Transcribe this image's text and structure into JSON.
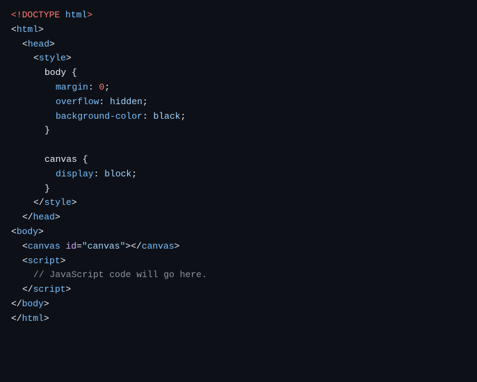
{
  "editor": {
    "background": "#0d1117",
    "lines": [
      {
        "indent": 0,
        "tokens": [
          {
            "type": "keyword",
            "text": "<!DOCTYPE "
          },
          {
            "type": "tag",
            "text": "html"
          },
          {
            "type": "keyword",
            "text": ">"
          }
        ]
      },
      {
        "indent": 0,
        "tokens": [
          {
            "type": "bracket",
            "text": "<"
          },
          {
            "type": "tag",
            "text": "html"
          },
          {
            "type": "bracket",
            "text": ">"
          }
        ]
      },
      {
        "indent": 1,
        "tokens": [
          {
            "type": "bracket",
            "text": "<"
          },
          {
            "type": "tag",
            "text": "head"
          },
          {
            "type": "bracket",
            "text": ">"
          }
        ]
      },
      {
        "indent": 2,
        "tokens": [
          {
            "type": "bracket",
            "text": "<"
          },
          {
            "type": "tag",
            "text": "style"
          },
          {
            "type": "bracket",
            "text": ">"
          }
        ]
      },
      {
        "indent": 3,
        "tokens": [
          {
            "type": "selector",
            "text": "body {"
          }
        ]
      },
      {
        "indent": 4,
        "tokens": [
          {
            "type": "prop",
            "text": "margin"
          },
          {
            "type": "plain",
            "text": ": "
          },
          {
            "type": "zero",
            "text": "0"
          },
          {
            "type": "plain",
            "text": ";"
          }
        ]
      },
      {
        "indent": 4,
        "tokens": [
          {
            "type": "prop",
            "text": "overflow"
          },
          {
            "type": "plain",
            "text": ": "
          },
          {
            "type": "cssval",
            "text": "hidden"
          },
          {
            "type": "plain",
            "text": ";"
          }
        ]
      },
      {
        "indent": 4,
        "tokens": [
          {
            "type": "prop",
            "text": "background-color"
          },
          {
            "type": "plain",
            "text": ": "
          },
          {
            "type": "cssval",
            "text": "black"
          },
          {
            "type": "plain",
            "text": ";"
          }
        ]
      },
      {
        "indent": 3,
        "tokens": [
          {
            "type": "plain",
            "text": "}"
          }
        ]
      },
      {
        "indent": 0,
        "tokens": []
      },
      {
        "indent": 3,
        "tokens": [
          {
            "type": "selector",
            "text": "canvas {"
          }
        ]
      },
      {
        "indent": 4,
        "tokens": [
          {
            "type": "prop",
            "text": "display"
          },
          {
            "type": "plain",
            "text": ": "
          },
          {
            "type": "cssval",
            "text": "block"
          },
          {
            "type": "plain",
            "text": ";"
          }
        ]
      },
      {
        "indent": 3,
        "tokens": [
          {
            "type": "plain",
            "text": "}"
          }
        ]
      },
      {
        "indent": 2,
        "tokens": [
          {
            "type": "bracket",
            "text": "</"
          },
          {
            "type": "tag",
            "text": "style"
          },
          {
            "type": "bracket",
            "text": ">"
          }
        ]
      },
      {
        "indent": 1,
        "tokens": [
          {
            "type": "bracket",
            "text": "</"
          },
          {
            "type": "tag",
            "text": "head"
          },
          {
            "type": "bracket",
            "text": ">"
          }
        ]
      },
      {
        "indent": 0,
        "tokens": [
          {
            "type": "bracket",
            "text": "<"
          },
          {
            "type": "tag",
            "text": "body"
          },
          {
            "type": "bracket",
            "text": ">"
          }
        ]
      },
      {
        "indent": 1,
        "tokens": [
          {
            "type": "bracket",
            "text": "<"
          },
          {
            "type": "tag",
            "text": "canvas"
          },
          {
            "type": "plain",
            "text": " "
          },
          {
            "type": "attrname",
            "text": "id"
          },
          {
            "type": "plain",
            "text": "="
          },
          {
            "type": "attrval",
            "text": "\"canvas\""
          },
          {
            "type": "bracket",
            "text": "></"
          },
          {
            "type": "tag",
            "text": "canvas"
          },
          {
            "type": "bracket",
            "text": ">"
          }
        ]
      },
      {
        "indent": 1,
        "tokens": [
          {
            "type": "bracket",
            "text": "<"
          },
          {
            "type": "tag",
            "text": "script"
          },
          {
            "type": "bracket",
            "text": ">"
          }
        ]
      },
      {
        "indent": 2,
        "tokens": [
          {
            "type": "comment",
            "text": "// JavaScript code will go here."
          }
        ]
      },
      {
        "indent": 1,
        "tokens": [
          {
            "type": "bracket",
            "text": "</"
          },
          {
            "type": "tag",
            "text": "script"
          },
          {
            "type": "bracket",
            "text": ">"
          }
        ]
      },
      {
        "indent": 0,
        "tokens": [
          {
            "type": "bracket",
            "text": "</"
          },
          {
            "type": "tag",
            "text": "body"
          },
          {
            "type": "bracket",
            "text": ">"
          }
        ]
      },
      {
        "indent": 0,
        "tokens": [
          {
            "type": "bracket",
            "text": "</"
          },
          {
            "type": "tag",
            "text": "html"
          },
          {
            "type": "bracket",
            "text": ">"
          }
        ]
      }
    ]
  }
}
